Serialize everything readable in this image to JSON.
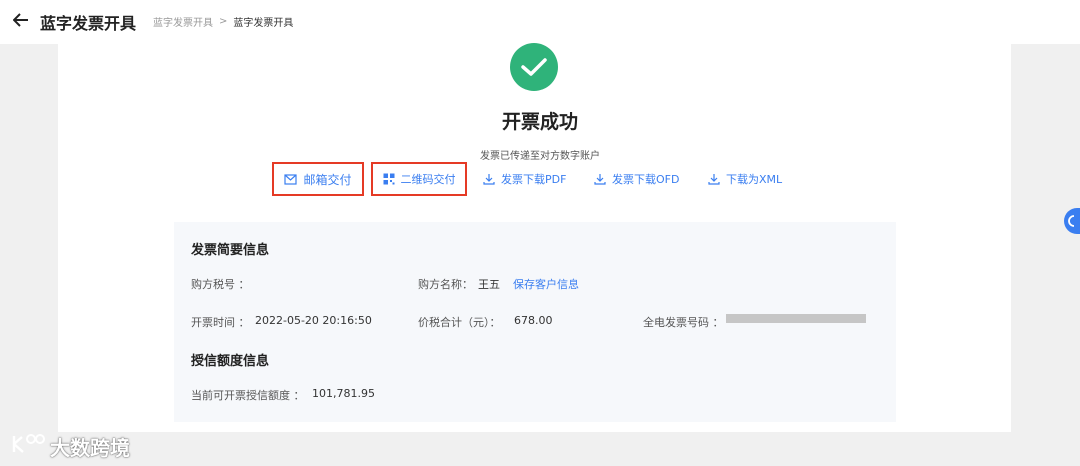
{
  "header": {
    "back_icon": "arrow-left-icon",
    "title": "蓝字发票开具",
    "breadcrumb": [
      "蓝字发票开具",
      "蓝字发票开具"
    ],
    "breadcrumb_separator": ">"
  },
  "success": {
    "icon": "check-icon",
    "icon_color": "#2fb37a",
    "title": "开票成功",
    "subtitle": "发票已传递至对方数字账户"
  },
  "actions": [
    {
      "label": "邮箱交付",
      "icon": "mail-icon",
      "highlighted": true
    },
    {
      "label": "二维码交付",
      "icon": "qrcode-icon",
      "highlighted": true
    },
    {
      "label": "发票下载PDF",
      "icon": "download-icon",
      "highlighted": false
    },
    {
      "label": "发票下载OFD",
      "icon": "download-icon",
      "highlighted": false
    },
    {
      "label": "下载为XML",
      "icon": "download-icon",
      "highlighted": false
    }
  ],
  "summary": {
    "title": "发票简要信息",
    "buyer_tax_no_label": "购方税号 ：",
    "buyer_tax_no": "",
    "buyer_name_label": "购方名称：",
    "buyer_name": "王五",
    "save_customer_link": "保存客户信息",
    "issue_time_label": "开票时间 ：",
    "issue_time": "2022-05-20 20:16:50",
    "total_label": "价税合计（元）：",
    "total": "678.00",
    "invoice_no_label": "全电发票号码 ："
  },
  "credit": {
    "title": "授信额度信息",
    "available_label": "当前可开票授信额度 ：",
    "available": "101,781.95"
  },
  "watermark": {
    "text": "大数跨境"
  },
  "colors": {
    "accent": "#3a7ef0",
    "success": "#2fb37a",
    "highlight_border": "#e53a25"
  }
}
